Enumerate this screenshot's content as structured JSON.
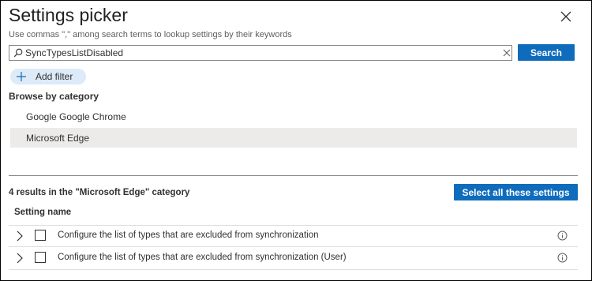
{
  "dialog": {
    "title": "Settings picker",
    "subtitle": "Use commas \",\" among search terms to lookup settings by their keywords"
  },
  "search": {
    "value": "SyncTypesListDisabled",
    "button_label": "Search"
  },
  "filter": {
    "add_filter_label": "Add filter"
  },
  "browse": {
    "heading": "Browse by category",
    "categories": [
      {
        "label": "Google Google Chrome",
        "selected": false
      },
      {
        "label": "Microsoft Edge",
        "selected": true
      }
    ]
  },
  "results": {
    "summary": "4 results in the \"Microsoft Edge\" category",
    "select_all_label": "Select all these settings",
    "column_header": "Setting name",
    "rows": [
      {
        "name": "Configure the list of types that are excluded from synchronization",
        "checked": false
      },
      {
        "name": "Configure the list of types that are excluded from synchronization (User)",
        "checked": false
      }
    ]
  },
  "icons": {
    "close": "close-icon",
    "search": "search-icon",
    "clear": "clear-icon",
    "add": "plus-icon",
    "expand": "chevron-right-icon",
    "info": "info-icon"
  },
  "colors": {
    "primary": "#0f6cbd",
    "selected_category_bg": "#edebe9",
    "add_filter_bg": "#ddeaf8"
  }
}
